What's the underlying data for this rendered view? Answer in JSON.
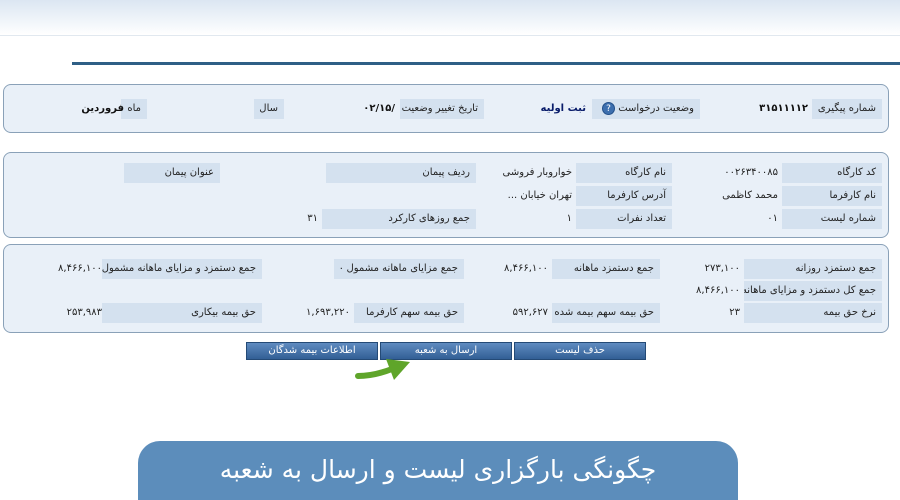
{
  "status_panel": {
    "tracking_label": "شماره پیگیری",
    "tracking_value": "۳۱۵۱۱۱۱۲",
    "request_status_label": "وضعیت درخواست",
    "help_icon": "?",
    "request_status_value": "ثبت اولیه",
    "status_date_label": "تاریخ تغییر وضعیت",
    "status_date_value": "/۰۲/۱۵",
    "year_label": "سال",
    "month_label": "ماه",
    "month_value": "فروردین"
  },
  "workshop_panel": {
    "workshop_code_label": "کد کارگاه",
    "workshop_code_value": "۰۰۲۶۳۴۰۰۸۵",
    "workshop_name_label": "نام کارگاه",
    "workshop_name_value": "خواروبار فروشی",
    "contract_row_label": "ردیف پیمان",
    "contract_title_label": "عنوان پیمان",
    "employer_name_label": "نام کارفرما",
    "employer_name_value": "محمد کاظمی",
    "employer_address_label": "آدرس کارفرما",
    "employer_address_value": "تهران خیابان ...",
    "list_number_label": "شماره لیست",
    "list_number_value": "۰۱",
    "headcount_label": "تعداد نفرات",
    "headcount_value": "۱",
    "work_days_label": "جمع روزهای کارکرد",
    "work_days_value": "۳۱"
  },
  "totals_panel": {
    "daily_wage_label": "جمع دستمزد روزانه",
    "daily_wage_value": "۲۷۳,۱۰۰",
    "monthly_wage_label": "جمع دستمزد ماهانه",
    "monthly_wage_value": "۸,۴۶۶,۱۰۰",
    "monthly_benefits_label": "جمع مزایای ماهانه مشمول",
    "monthly_benefits_value": "۰",
    "wage_benefits_label": "جمع دستمزد و مزایای ماهانه مشمول",
    "wage_benefits_value": "۸,۴۶۶,۱۰۰",
    "total_wage_benefits_label": "جمع کل دستمزد و مزایای ماهانه",
    "total_wage_benefits_value": "۸,۴۶۶,۱۰۰",
    "insurance_rate_label": "نرخ حق بیمه",
    "insurance_rate_value": "۲۳",
    "insured_share_label": "حق بیمه سهم بیمه شده",
    "insured_share_value": "۵۹۲,۶۲۷",
    "employer_share_label": "حق بیمه سهم کارفرما",
    "employer_share_value": "۱,۶۹۳,۲۲۰",
    "unemployment_label": "حق بیمه بیکاری",
    "unemployment_value": "۲۵۳,۹۸۳"
  },
  "actions": {
    "delete_list": "حذف لیست",
    "send_to_branch": "ارسال به شعبه",
    "insured_info": "اطلاعات بیمه شدگان"
  },
  "colors": {
    "accent": "#2f5f86",
    "arrow": "#5fa52a",
    "banner": "#5c8dbb"
  },
  "banner_text": "چگونگی بارگزاری لیست و ارسال به شعبه"
}
